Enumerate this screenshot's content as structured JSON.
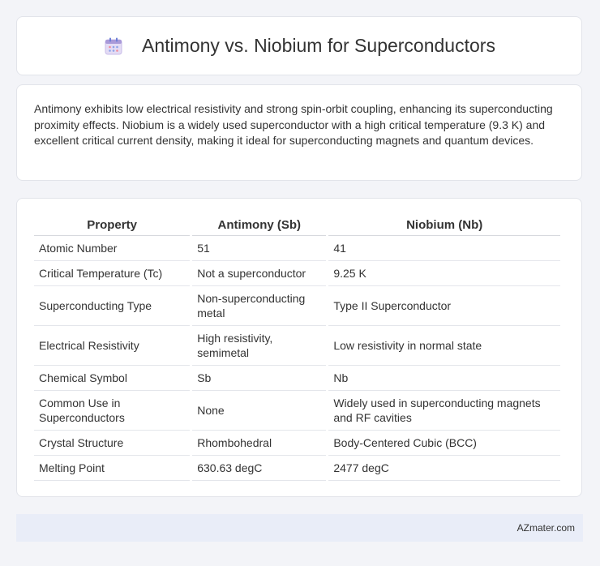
{
  "header": {
    "icon": "calendar-icon",
    "title": "Antimony vs. Niobium for Superconductors"
  },
  "summary": {
    "text": "Antimony exhibits low electrical resistivity and strong spin-orbit coupling, enhancing its superconducting proximity effects. Niobium is a widely used superconductor with a high critical temperature (9.3 K) and excellent critical current density, making it ideal for superconducting magnets and quantum devices."
  },
  "table": {
    "headers": [
      "Property",
      "Antimony (Sb)",
      "Niobium (Nb)"
    ],
    "rows": [
      [
        "Atomic Number",
        "51",
        "41"
      ],
      [
        "Critical Temperature (Tc)",
        "Not a superconductor",
        "9.25 K"
      ],
      [
        "Superconducting Type",
        "Non-superconducting metal",
        "Type II Superconductor"
      ],
      [
        "Electrical Resistivity",
        "High resistivity, semimetal",
        "Low resistivity in normal state"
      ],
      [
        "Chemical Symbol",
        "Sb",
        "Nb"
      ],
      [
        "Common Use in Superconductors",
        "None",
        "Widely used in superconducting magnets and RF cavities"
      ],
      [
        "Crystal Structure",
        "Rhombohedral",
        "Body-Centered Cubic (BCC)"
      ],
      [
        "Melting Point",
        "630.63 degC",
        "2477 degC"
      ]
    ]
  },
  "footer": {
    "brand": "AZmater.com"
  }
}
